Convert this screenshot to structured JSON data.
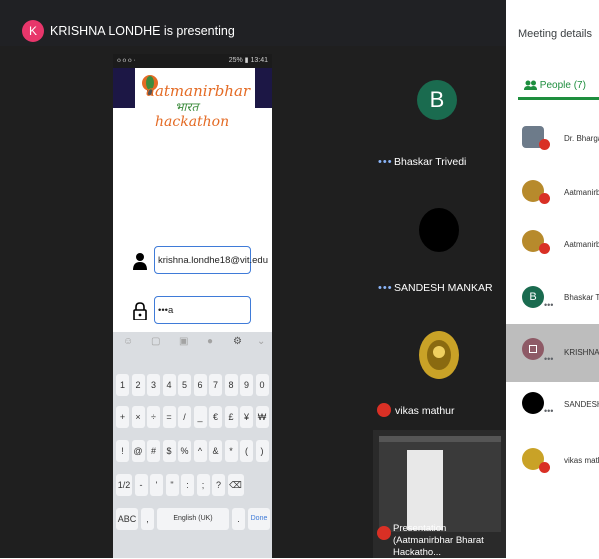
{
  "banner": {
    "initial": "K",
    "text": "KRISHNA LONDHE is presenting"
  },
  "phone": {
    "status_left": "᧐ ᧐ ᧐  ·",
    "status_right": "25% ▮ 13:41",
    "logo": {
      "line1": "aatmanirbhar",
      "line2": "भारत",
      "line3": "hackathon"
    },
    "email_value": "krishna.londhe18@vit.edu",
    "password_value": "•••a",
    "keyboard": {
      "row1": [
        "1",
        "2",
        "3",
        "4",
        "5",
        "6",
        "7",
        "8",
        "9",
        "0"
      ],
      "row2": [
        "+",
        "×",
        "÷",
        "=",
        "/",
        "_",
        "€",
        "£",
        "¥",
        "₩"
      ],
      "row3": [
        "!",
        "@",
        "#",
        "$",
        "%",
        "^",
        "&",
        "*",
        "(",
        ")"
      ],
      "row4": [
        "1/2",
        "-",
        "'",
        "\"",
        ":",
        ";",
        "?",
        "⌫"
      ],
      "abc": "ABC",
      "comma": ",",
      "space": "English (UK)",
      "dot": ".",
      "done": "Done"
    }
  },
  "tiles": [
    {
      "name": "Bhaskar Trivedi",
      "initial": "B"
    },
    {
      "name": "SANDESH MANKAR"
    },
    {
      "name": "vikas mathur"
    },
    {
      "name": "Presentation (Aatmanirbhar Bharat Hackatho..."
    }
  ],
  "panel": {
    "title": "Meeting details",
    "people_tab": "People (7)",
    "people": [
      {
        "name": "Dr. Bhargav",
        "avatar": "photo"
      },
      {
        "name": "Aatmanirbh",
        "avatar": "logo"
      },
      {
        "name": "Aatmanirbh",
        "avatar": "logo"
      },
      {
        "name": "Bhaskar Tri",
        "avatar": "B"
      },
      {
        "name": "KRISHNA L",
        "avatar": "present"
      },
      {
        "name": "SANDESH M",
        "avatar": "black"
      },
      {
        "name": "vikas math",
        "avatar": "gold"
      }
    ]
  },
  "colors": {
    "accent_green": "#1e8e3e",
    "mic_off_red": "#d93025",
    "banner_pink": "#e8366b"
  }
}
